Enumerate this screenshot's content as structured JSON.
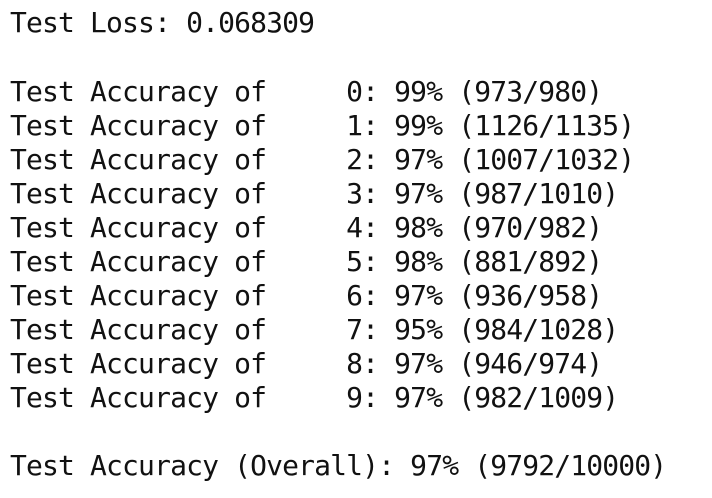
{
  "test_loss": "Test Loss: 0.068309",
  "class_accuracy_lines": [
    "Test Accuracy of     0: 99% (973/980)",
    "Test Accuracy of     1: 99% (1126/1135)",
    "Test Accuracy of     2: 97% (1007/1032)",
    "Test Accuracy of     3: 97% (987/1010)",
    "Test Accuracy of     4: 98% (970/982)",
    "Test Accuracy of     5: 98% (881/892)",
    "Test Accuracy of     6: 97% (936/958)",
    "Test Accuracy of     7: 95% (984/1028)",
    "Test Accuracy of     8: 97% (946/974)",
    "Test Accuracy of     9: 97% (982/1009)"
  ],
  "overall_accuracy": "Test Accuracy (Overall): 97% (9792/10000)"
}
